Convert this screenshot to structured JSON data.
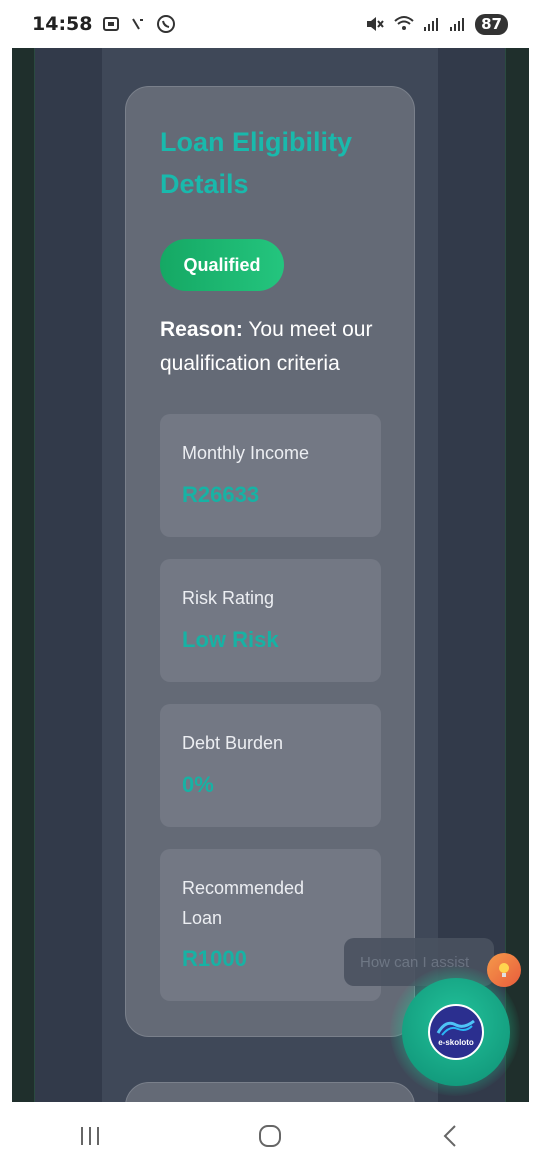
{
  "status_bar": {
    "time": "14:58",
    "battery": "87",
    "icons": [
      "screenshot-icon",
      "missed-call-icon",
      "whatsapp-icon",
      "mute-icon",
      "wifi-icon",
      "signal-icon",
      "signal-icon-2"
    ]
  },
  "card": {
    "title": "Loan Eligibility Details",
    "status_badge": "Qualified",
    "reason_label": "Reason:",
    "reason_text": "You meet our qualification criteria",
    "metrics": [
      {
        "label": "Monthly Income",
        "value": "R26633"
      },
      {
        "label": "Risk Rating",
        "value": "Low Risk"
      },
      {
        "label": "Debt Burden",
        "value": "0%"
      },
      {
        "label": "Recommended Loan",
        "value": "R1000"
      }
    ]
  },
  "chat": {
    "hint": "How can I assist",
    "logo_text": "e-skoloto",
    "bulb_icon": "lightbulb-icon"
  },
  "nav": {
    "recent": "recent-apps-icon",
    "home": "home-icon",
    "back": "back-icon"
  },
  "colors": {
    "accent": "#19b9ac",
    "badge_green": "#1db56f",
    "card_bg": "#646a76",
    "page_bg": "#323a4a"
  }
}
